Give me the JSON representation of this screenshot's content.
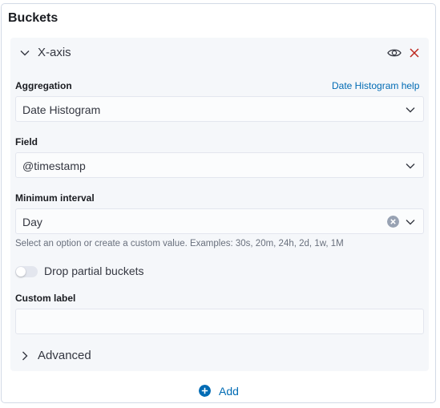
{
  "panel": {
    "title": "Buckets"
  },
  "bucket": {
    "title": "X-axis",
    "aggregation": {
      "label": "Aggregation",
      "help_link": "Date Histogram help",
      "value": "Date Histogram"
    },
    "field": {
      "label": "Field",
      "value": "@timestamp"
    },
    "minimum_interval": {
      "label": "Minimum interval",
      "value": "Day",
      "help_text": "Select an option or create a custom value. Examples: 30s, 20m, 24h, 2d, 1w, 1M"
    },
    "drop_partial": {
      "label": "Drop partial buckets",
      "enabled": false
    },
    "custom_label": {
      "label": "Custom label",
      "value": ""
    },
    "advanced": {
      "label": "Advanced"
    }
  },
  "add_button": {
    "label": "Add"
  },
  "colors": {
    "link": "#006bb4",
    "danger": "#bd271e",
    "section_bg": "#f5f7fa"
  }
}
